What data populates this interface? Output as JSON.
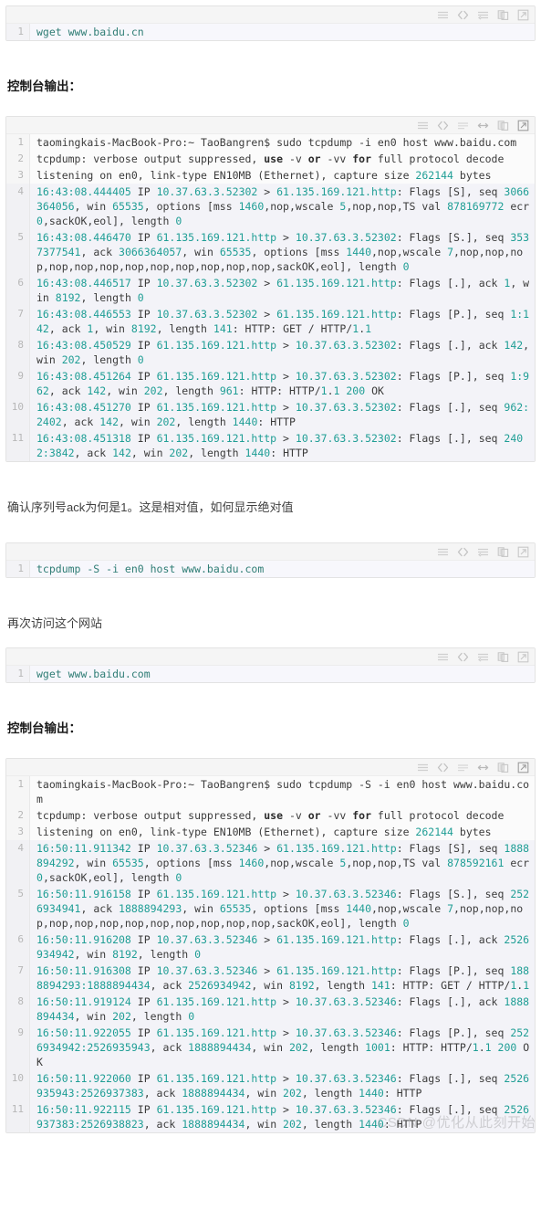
{
  "toolbar_icons_code": [
    "menu-icon",
    "code-icon",
    "wrap-icon",
    "copy-icon",
    "expand-icon"
  ],
  "toolbar_icons_console": [
    "menu-icon",
    "code-icon",
    "wrap-icon",
    "resize-horizontal-icon",
    "copy-icon",
    "expand-icon"
  ],
  "blocks": {
    "cmd1": {
      "lines": [
        {
          "n": "1",
          "text": "wget www.baidu.cn"
        }
      ]
    },
    "cmd2": {
      "lines": [
        {
          "n": "1",
          "text": "tcpdump -S -i en0 host www.baidu.com"
        }
      ]
    },
    "cmd3": {
      "lines": [
        {
          "n": "1",
          "text": "wget www.baidu.com"
        }
      ]
    },
    "console1": {
      "lines": [
        {
          "n": "1",
          "text": "taomingkais-MacBook-Pro:~ TaoBangren$ sudo tcpdump -i en0 host www.baidu.com"
        },
        {
          "n": "2",
          "text": "tcpdump: verbose output suppressed, use -v or -vv for full protocol decode"
        },
        {
          "n": "3",
          "text": "listening on en0, link-type EN10MB (Ethernet), capture size 262144 bytes"
        },
        {
          "n": "4",
          "text": "16:43:08.444405 IP 10.37.63.3.52302 > 61.135.169.121.http: Flags [S], seq 3066364056, win 65535, options [mss 1460,nop,wscale 5,nop,nop,TS val 878169772 ecr 0,sackOK,eol], length 0"
        },
        {
          "n": "5",
          "text": "16:43:08.446470 IP 61.135.169.121.http > 10.37.63.3.52302: Flags [S.], seq 3537377541, ack 3066364057, win 65535, options [mss 1440,nop,wscale 7,nop,nop,nop,nop,nop,nop,nop,nop,nop,nop,nop,nop,sackOK,eol], length 0"
        },
        {
          "n": "6",
          "text": "16:43:08.446517 IP 10.37.63.3.52302 > 61.135.169.121.http: Flags [.], ack 1, win 8192, length 0"
        },
        {
          "n": "7",
          "text": "16:43:08.446553 IP 10.37.63.3.52302 > 61.135.169.121.http: Flags [P.], seq 1:142, ack 1, win 8192, length 141: HTTP: GET / HTTP/1.1"
        },
        {
          "n": "8",
          "text": "16:43:08.450529 IP 61.135.169.121.http > 10.37.63.3.52302: Flags [.], ack 142, win 202, length 0"
        },
        {
          "n": "9",
          "text": "16:43:08.451264 IP 61.135.169.121.http > 10.37.63.3.52302: Flags [P.], seq 1:962, ack 142, win 202, length 961: HTTP: HTTP/1.1 200 OK"
        },
        {
          "n": "10",
          "text": "16:43:08.451270 IP 61.135.169.121.http > 10.37.63.3.52302: Flags [.], seq 962:2402, ack 142, win 202, length 1440: HTTP"
        },
        {
          "n": "11",
          "text": "16:43:08.451318 IP 61.135.169.121.http > 10.37.63.3.52302: Flags [.], seq 2402:3842, ack 142, win 202, length 1440: HTTP"
        }
      ]
    },
    "console2": {
      "lines": [
        {
          "n": "1",
          "text": "taomingkais-MacBook-Pro:~ TaoBangren$ sudo tcpdump -S -i en0 host www.baidu.com"
        },
        {
          "n": "2",
          "text": "tcpdump: verbose output suppressed, use -v or -vv for full protocol decode"
        },
        {
          "n": "3",
          "text": "listening on en0, link-type EN10MB (Ethernet), capture size 262144 bytes"
        },
        {
          "n": "4",
          "text": "16:50:11.911342 IP 10.37.63.3.52346 > 61.135.169.121.http: Flags [S], seq 1888894292, win 65535, options [mss 1460,nop,wscale 5,nop,nop,TS val 878592161 ecr 0,sackOK,eol], length 0"
        },
        {
          "n": "5",
          "text": "16:50:11.916158 IP 61.135.169.121.http > 10.37.63.3.52346: Flags [S.], seq 2526934941, ack 1888894293, win 65535, options [mss 1440,nop,wscale 7,nop,nop,nop,nop,nop,nop,nop,nop,nop,nop,nop,nop,sackOK,eol], length 0"
        },
        {
          "n": "6",
          "text": "16:50:11.916208 IP 10.37.63.3.52346 > 61.135.169.121.http: Flags [.], ack 2526934942, win 8192, length 0"
        },
        {
          "n": "7",
          "text": "16:50:11.916308 IP 10.37.63.3.52346 > 61.135.169.121.http: Flags [P.], seq 1888894293:1888894434, ack 2526934942, win 8192, length 141: HTTP: GET / HTTP/1.1"
        },
        {
          "n": "8",
          "text": "16:50:11.919124 IP 61.135.169.121.http > 10.37.63.3.52346: Flags [.], ack 1888894434, win 202, length 0"
        },
        {
          "n": "9",
          "text": "16:50:11.922055 IP 61.135.169.121.http > 10.37.63.3.52346: Flags [P.], seq 2526934942:2526935943, ack 1888894434, win 202, length 1001: HTTP: HTTP/1.1 200 OK"
        },
        {
          "n": "10",
          "text": "16:50:11.922060 IP 61.135.169.121.http > 10.37.63.3.52346: Flags [.], seq 2526935943:2526937383, ack 1888894434, win 202, length 1440: HTTP"
        },
        {
          "n": "11",
          "text": "16:50:11.922115 IP 61.135.169.121.http > 10.37.63.3.52346: Flags [.], seq 2526937383:2526938823, ack 1888894434, win 202, length 1440: HTTP"
        }
      ]
    }
  },
  "prose": {
    "console_label_1": "控制台输出：",
    "note_ack": "确认序列号ack为何是1。这是相对值，如何显示绝对值",
    "note_revisit": "再次访问这个网站",
    "console_label_2": "控制台输出："
  },
  "watermark": "CSDN @优化从此刻开始",
  "colors": {
    "accent_teal": "#1f9e95",
    "code_bg": "#fbfbfb",
    "alt_line_bg": "#f3f3f8",
    "gutter_text": "#b7b7b7",
    "border": "#e3e3e3"
  }
}
